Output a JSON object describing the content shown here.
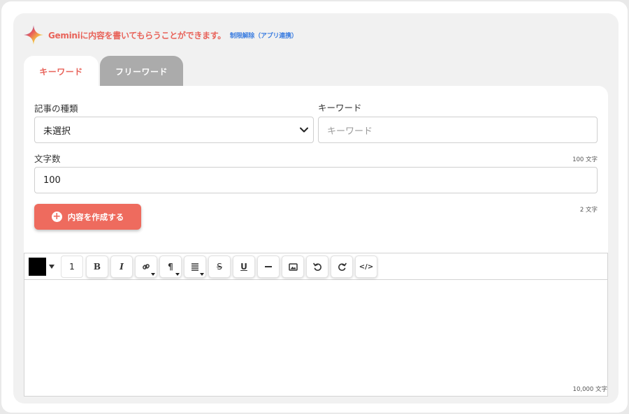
{
  "header": {
    "text": "Geminiに内容を書いてもらうことができます。",
    "link": "制限解除（アプリ連携）",
    "accent_color": "#e8635a",
    "link_color": "#3b7de0"
  },
  "tabs": [
    {
      "label": "キーワード",
      "active": true
    },
    {
      "label": "フリーワード",
      "active": false
    }
  ],
  "form": {
    "article_type": {
      "label": "記事の種類",
      "value": "未選択"
    },
    "keyword": {
      "label": "キーワード",
      "placeholder": "キーワード",
      "counter": "100 文字"
    },
    "char_count": {
      "label": "文字数",
      "value": "100",
      "counter": "2 文字"
    },
    "create_button": "内容を作成する"
  },
  "editor": {
    "font_color": "#000000",
    "font_size": "1",
    "toolbar_icons": [
      "bold-icon",
      "italic-icon",
      "link-icon",
      "paragraph-icon",
      "align-icon",
      "strikethrough-icon",
      "underline-icon",
      "horizontal-rule-icon",
      "image-icon",
      "undo-icon",
      "redo-icon",
      "code-icon"
    ],
    "bold": "B",
    "italic": "I",
    "paragraph": "¶",
    "strike": "S",
    "underline": "U",
    "code": "</>",
    "counter": "10,000 文字"
  }
}
